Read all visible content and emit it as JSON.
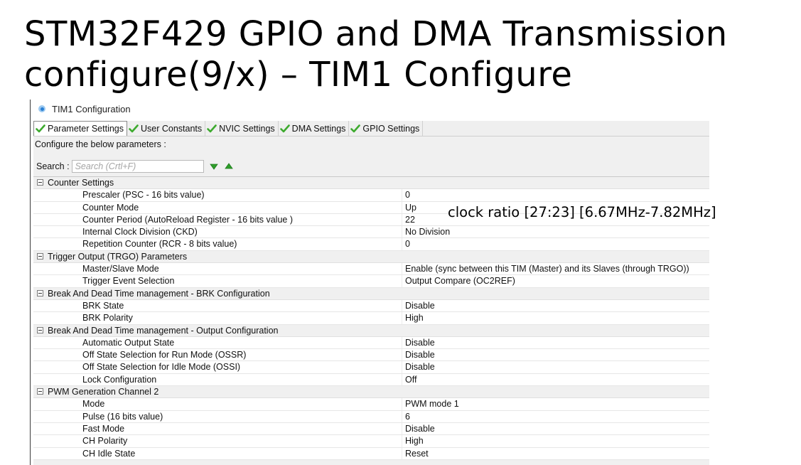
{
  "slide": {
    "title_line1": "STM32F429 GPIO and DMA Transmission",
    "title_line2": "configure(9/x) – TIM1 Configure",
    "annotation": "clock ratio [27:23] [6.67MHz-7.82MHz]"
  },
  "window": {
    "title": "TIM1 Configuration"
  },
  "tabs": [
    {
      "label": "Parameter Settings",
      "active": true
    },
    {
      "label": "User Constants",
      "active": false
    },
    {
      "label": "NVIC Settings",
      "active": false
    },
    {
      "label": "DMA Settings",
      "active": false
    },
    {
      "label": "GPIO Settings",
      "active": false
    }
  ],
  "panel": {
    "configure_label": "Configure the below parameters :",
    "search_label": "Search :",
    "search_placeholder": "Search (Crtl+F)"
  },
  "groups": [
    {
      "label": "Counter Settings",
      "params": [
        {
          "name": "Prescaler (PSC - 16 bits value)",
          "value": "0"
        },
        {
          "name": "Counter Mode",
          "value": "Up"
        },
        {
          "name": "Counter Period (AutoReload Register - 16 bits value )",
          "value": "22"
        },
        {
          "name": "Internal Clock Division (CKD)",
          "value": "No Division"
        },
        {
          "name": "Repetition Counter (RCR - 8 bits value)",
          "value": "0"
        }
      ]
    },
    {
      "label": "Trigger Output (TRGO) Parameters",
      "params": [
        {
          "name": "Master/Slave Mode",
          "value": "Enable (sync between this TIM (Master) and its Slaves (through TRGO))"
        },
        {
          "name": "Trigger Event Selection",
          "value": "Output Compare (OC2REF)"
        }
      ]
    },
    {
      "label": "Break And Dead Time management - BRK Configuration",
      "params": [
        {
          "name": "BRK State",
          "value": "Disable"
        },
        {
          "name": "BRK Polarity",
          "value": "High"
        }
      ]
    },
    {
      "label": "Break And Dead Time management - Output Configuration",
      "params": [
        {
          "name": "Automatic Output State",
          "value": "Disable"
        },
        {
          "name": "Off State Selection for Run Mode (OSSR)",
          "value": "Disable"
        },
        {
          "name": "Off State Selection for Idle Mode (OSSI)",
          "value": "Disable"
        },
        {
          "name": "Lock Configuration",
          "value": "Off"
        }
      ]
    },
    {
      "label": "PWM Generation Channel 2",
      "params": [
        {
          "name": "Mode",
          "value": "PWM mode 1"
        },
        {
          "name": "Pulse (16 bits value)",
          "value": "6"
        },
        {
          "name": "Fast Mode",
          "value": "Disable"
        },
        {
          "name": "CH Polarity",
          "value": "High"
        },
        {
          "name": "CH Idle State",
          "value": "Reset"
        }
      ]
    }
  ],
  "colors": {
    "check_green": "#3daa2e",
    "arrow_green": "#2e9e2a"
  }
}
